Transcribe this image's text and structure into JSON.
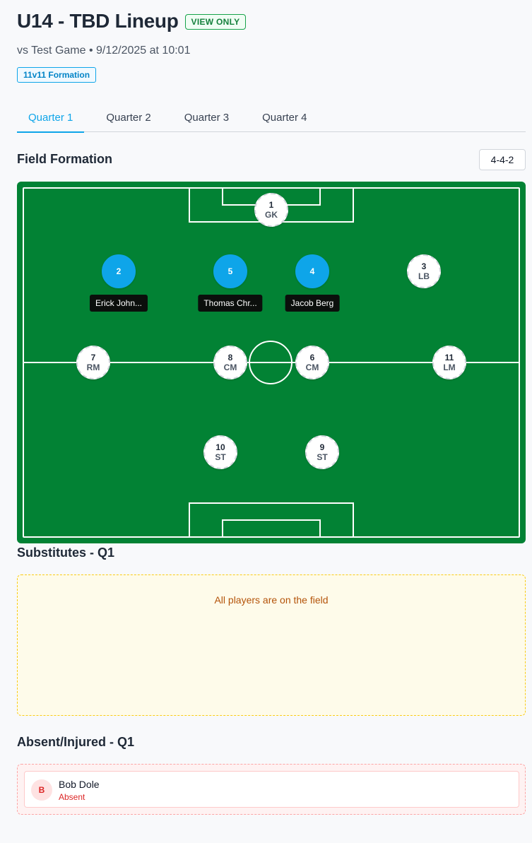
{
  "header": {
    "title": "U14 - TBD Lineup",
    "view_badge": "VIEW ONLY",
    "subtitle": "vs Test Game • 9/12/2025 at 10:01",
    "formation_badge": "11v11 Formation"
  },
  "tabs": [
    {
      "label": "Quarter 1",
      "active": true
    },
    {
      "label": "Quarter 2",
      "active": false
    },
    {
      "label": "Quarter 3",
      "active": false
    },
    {
      "label": "Quarter 4",
      "active": false
    }
  ],
  "field_section": {
    "title": "Field Formation",
    "formation_value": "4-4-2"
  },
  "positions": [
    {
      "number": "1",
      "position": "GK",
      "player": null
    },
    {
      "number": "2",
      "position": "",
      "player": "Erick John..."
    },
    {
      "number": "5",
      "position": "",
      "player": "Thomas Chr..."
    },
    {
      "number": "4",
      "position": "",
      "player": "Jacob Berg"
    },
    {
      "number": "3",
      "position": "LB",
      "player": null
    },
    {
      "number": "7",
      "position": "RM",
      "player": null
    },
    {
      "number": "8",
      "position": "CM",
      "player": null
    },
    {
      "number": "6",
      "position": "CM",
      "player": null
    },
    {
      "number": "11",
      "position": "LM",
      "player": null
    },
    {
      "number": "10",
      "position": "ST",
      "player": null
    },
    {
      "number": "9",
      "position": "ST",
      "player": null
    }
  ],
  "substitutes": {
    "title": "Substitutes - Q1",
    "empty_text": "All players are on the field"
  },
  "absent": {
    "title": "Absent/Injured - Q1",
    "players": [
      {
        "initial": "B",
        "name": "Bob Dole",
        "status": "Absent"
      }
    ]
  },
  "colors": {
    "field": "#028234",
    "accent": "#0ea5e9",
    "view_only": "#15803d",
    "absent": "#dc2626"
  }
}
